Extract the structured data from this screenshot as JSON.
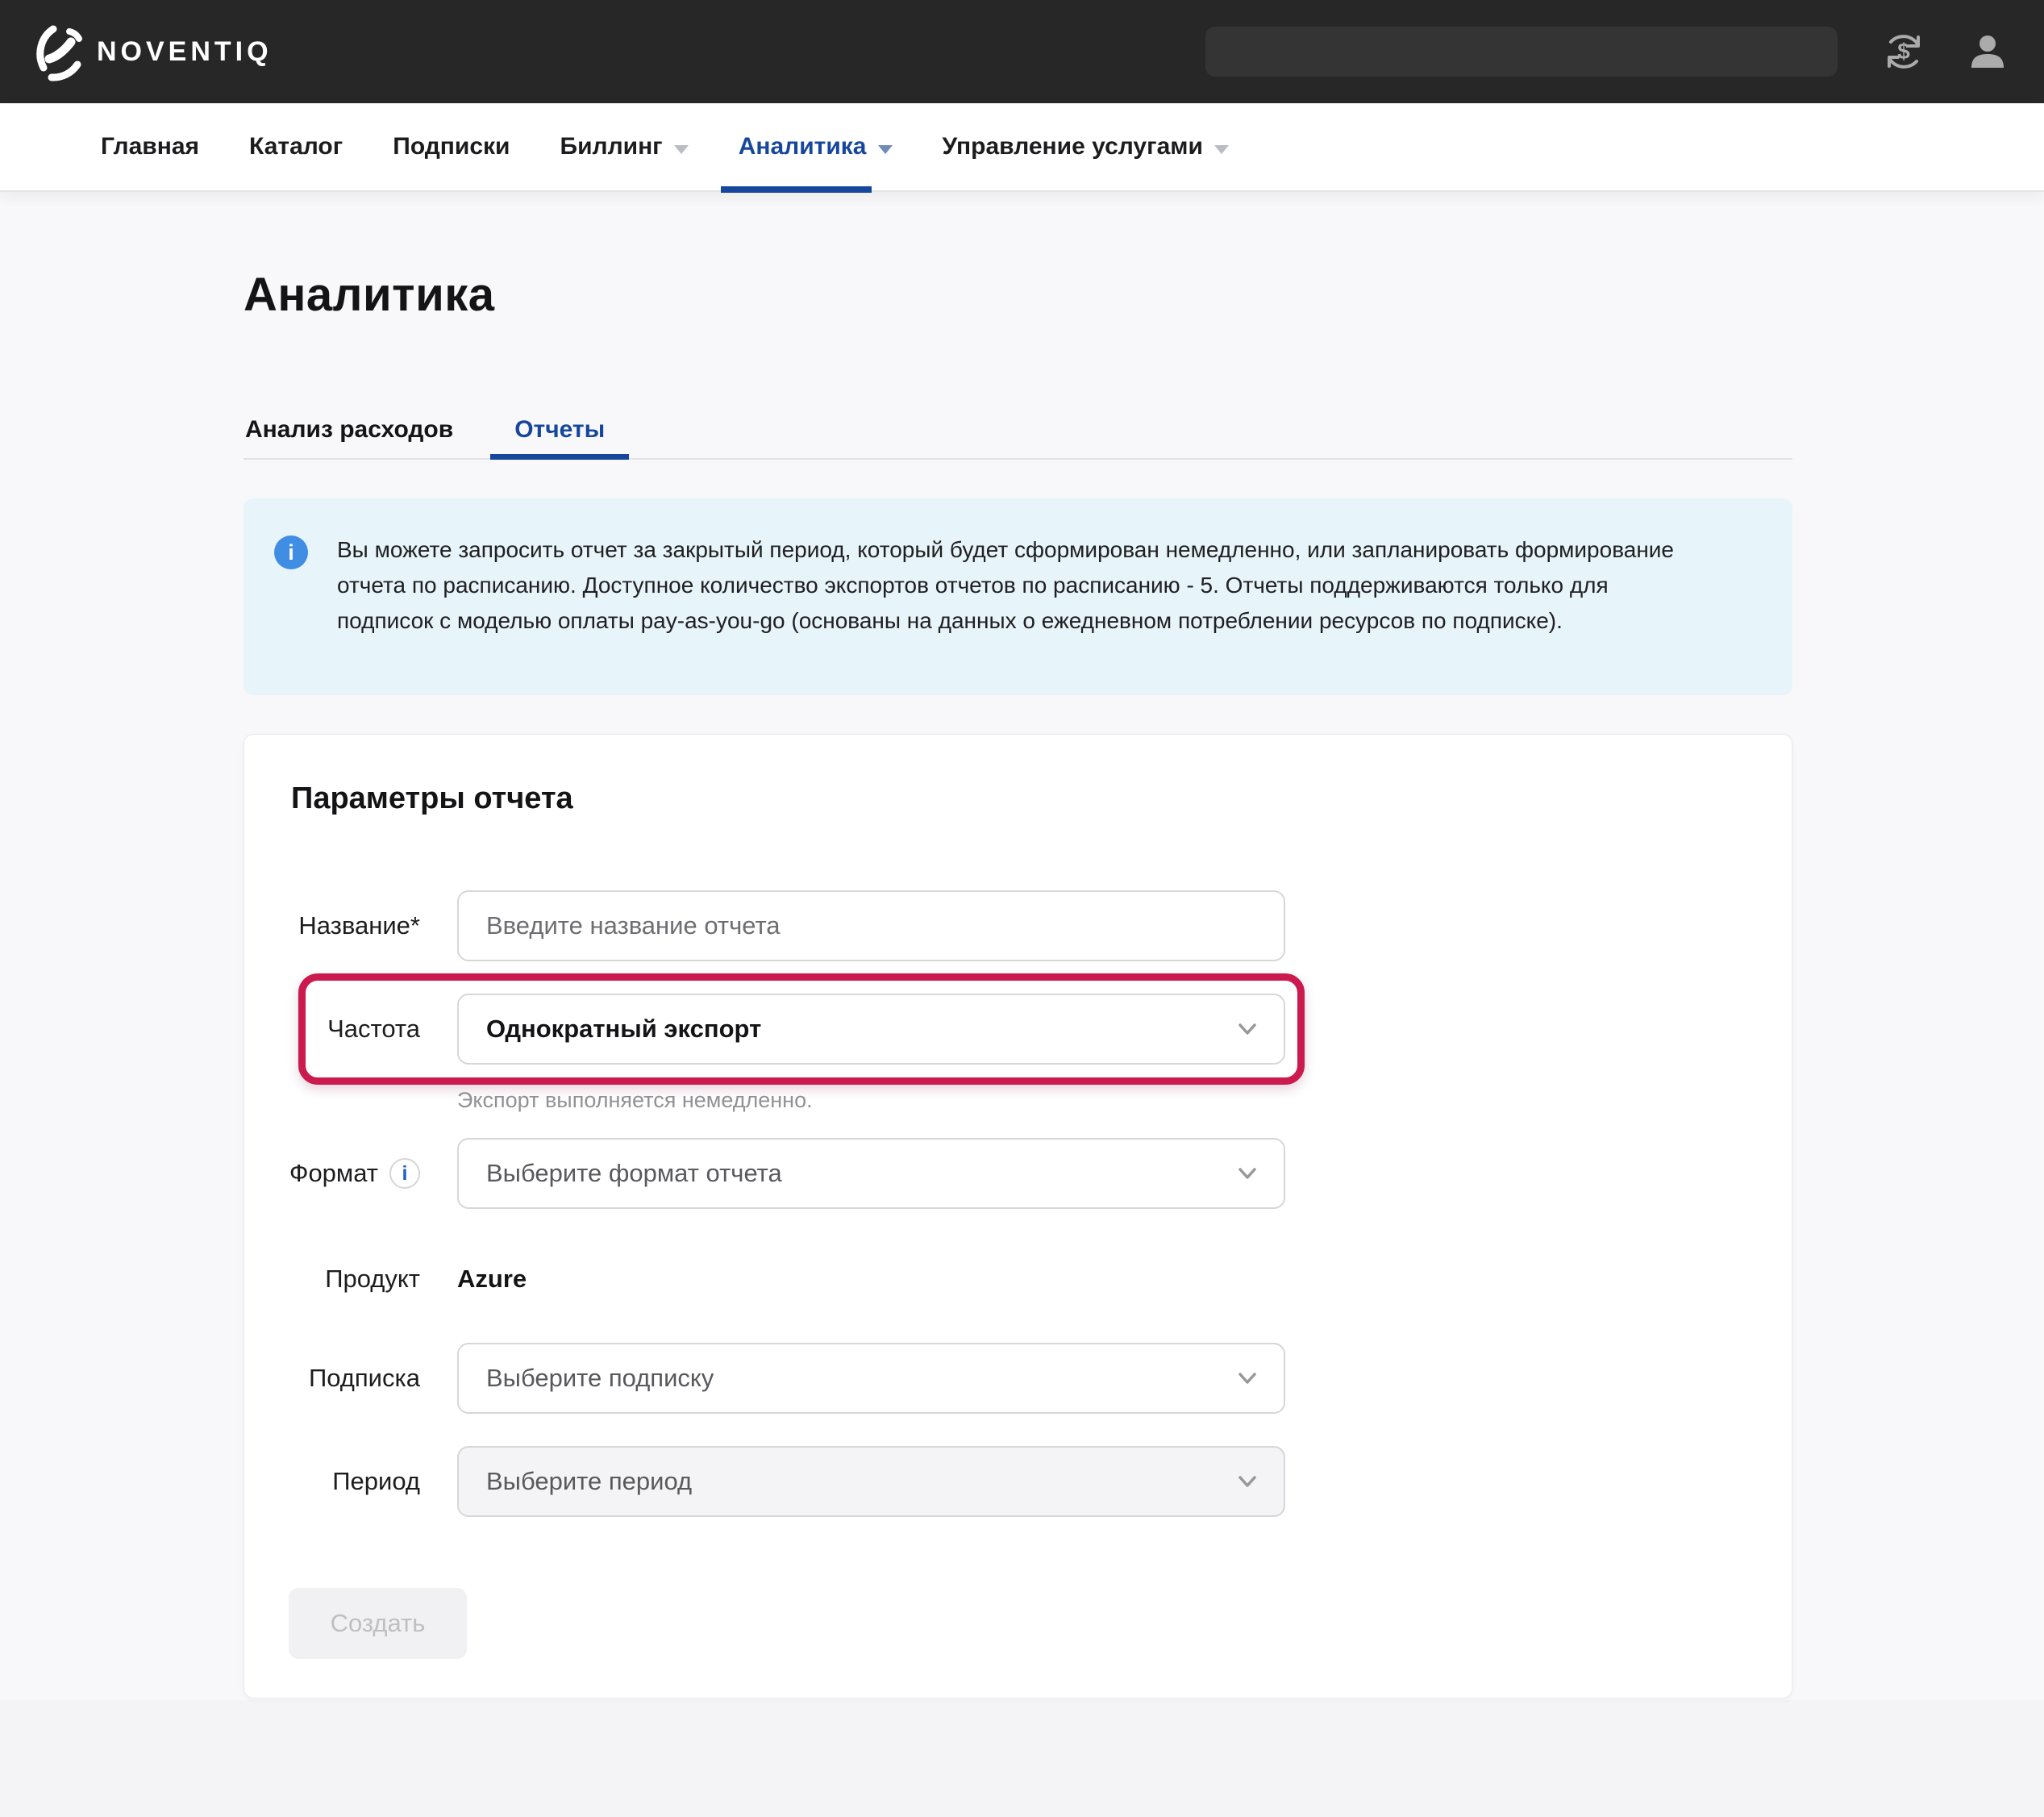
{
  "colors": {
    "accent_blue": "#17479c",
    "annotation_red": "#cb1a4e",
    "banner_bg": "#e7f4f9",
    "banner_icon_blue": "#3f8ee4",
    "header_bg": "#272727"
  },
  "header": {
    "logo_text": "NOVENTIQ",
    "search": {
      "placeholder": "",
      "value": ""
    },
    "icons": {
      "currency": "currency-exchange-icon",
      "user": "user-icon"
    }
  },
  "nav": {
    "items": [
      {
        "label": "Главная",
        "active": false,
        "dropdown": false
      },
      {
        "label": "Каталог",
        "active": false,
        "dropdown": false
      },
      {
        "label": "Подписки",
        "active": false,
        "dropdown": false
      },
      {
        "label": "Биллинг",
        "active": false,
        "dropdown": true
      },
      {
        "label": "Аналитика",
        "active": true,
        "dropdown": true
      },
      {
        "label": "Управление услугами",
        "active": false,
        "dropdown": true
      }
    ]
  },
  "page": {
    "title": "Аналитика"
  },
  "tabs": [
    {
      "label": "Анализ расходов",
      "active": false
    },
    {
      "label": "Отчеты",
      "active": true
    }
  ],
  "info_banner": {
    "icon_glyph": "i",
    "text": "Вы можете запросить отчет за закрытый период, который будет сформирован немедленно, или запланировать формирование отчета по расписанию. Доступное количество экспортов отчетов по расписанию - 5. Отчеты поддерживаются только для подписок с моделью оплаты pay-as-you-go (основаны на данных о ежедневном потреблении ресурсов по подписке)."
  },
  "form": {
    "heading": "Параметры отчета",
    "name": {
      "label": "Название*",
      "placeholder": "Введите название отчета",
      "value": ""
    },
    "frequency": {
      "label": "Частота",
      "value": "Однократный экспорт",
      "helper": "Экспорт выполняется немедленно."
    },
    "format": {
      "label": "Формат",
      "info_glyph": "i",
      "placeholder": "Выберите формат отчета"
    },
    "product": {
      "label": "Продукт",
      "value": "Azure"
    },
    "subscription": {
      "label": "Подписка",
      "placeholder": "Выберите подписку"
    },
    "period": {
      "label": "Период",
      "placeholder": "Выберите период"
    },
    "submit_label": "Создать"
  }
}
